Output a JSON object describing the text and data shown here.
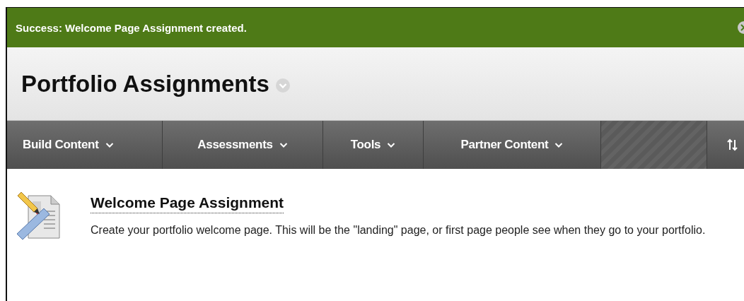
{
  "success_message": {
    "text": "Success: Welcome Page Assignment created."
  },
  "page_title": "Portfolio Assignments",
  "menu": [
    {
      "label": "Build Content"
    },
    {
      "label": "Assessments"
    },
    {
      "label": "Tools"
    },
    {
      "label": "Partner Content"
    }
  ],
  "content_items": [
    {
      "title": "Welcome Page Assignment",
      "description": "Create your portfolio welcome page. This will be the \"landing\" page, or first page people see when they go to your portfolio."
    }
  ]
}
